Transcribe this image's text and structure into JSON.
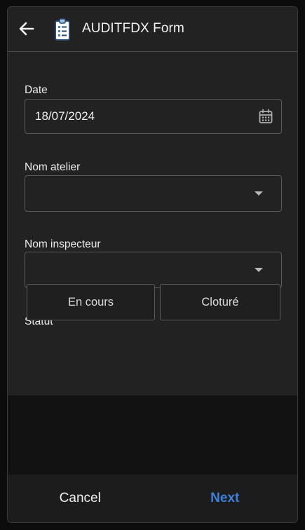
{
  "header": {
    "title": "AUDITFDX Form",
    "back_icon": "arrow-left-icon",
    "form_icon": "clipboard-icon"
  },
  "form": {
    "date": {
      "label": "Date",
      "value": "18/07/2024",
      "icon": "calendar-icon"
    },
    "nom_atelier": {
      "label": "Nom atelier",
      "value": ""
    },
    "nom_inspecteur": {
      "label": "Nom inspecteur",
      "value": ""
    },
    "statut": {
      "label": "Statut",
      "options": [
        "En cours",
        "Cloturé"
      ]
    }
  },
  "footer": {
    "cancel_label": "Cancel",
    "next_label": "Next"
  },
  "colors": {
    "accent": "#3d7fd9",
    "surface": "#222222",
    "background": "#121212",
    "border": "#5a5a5a"
  }
}
